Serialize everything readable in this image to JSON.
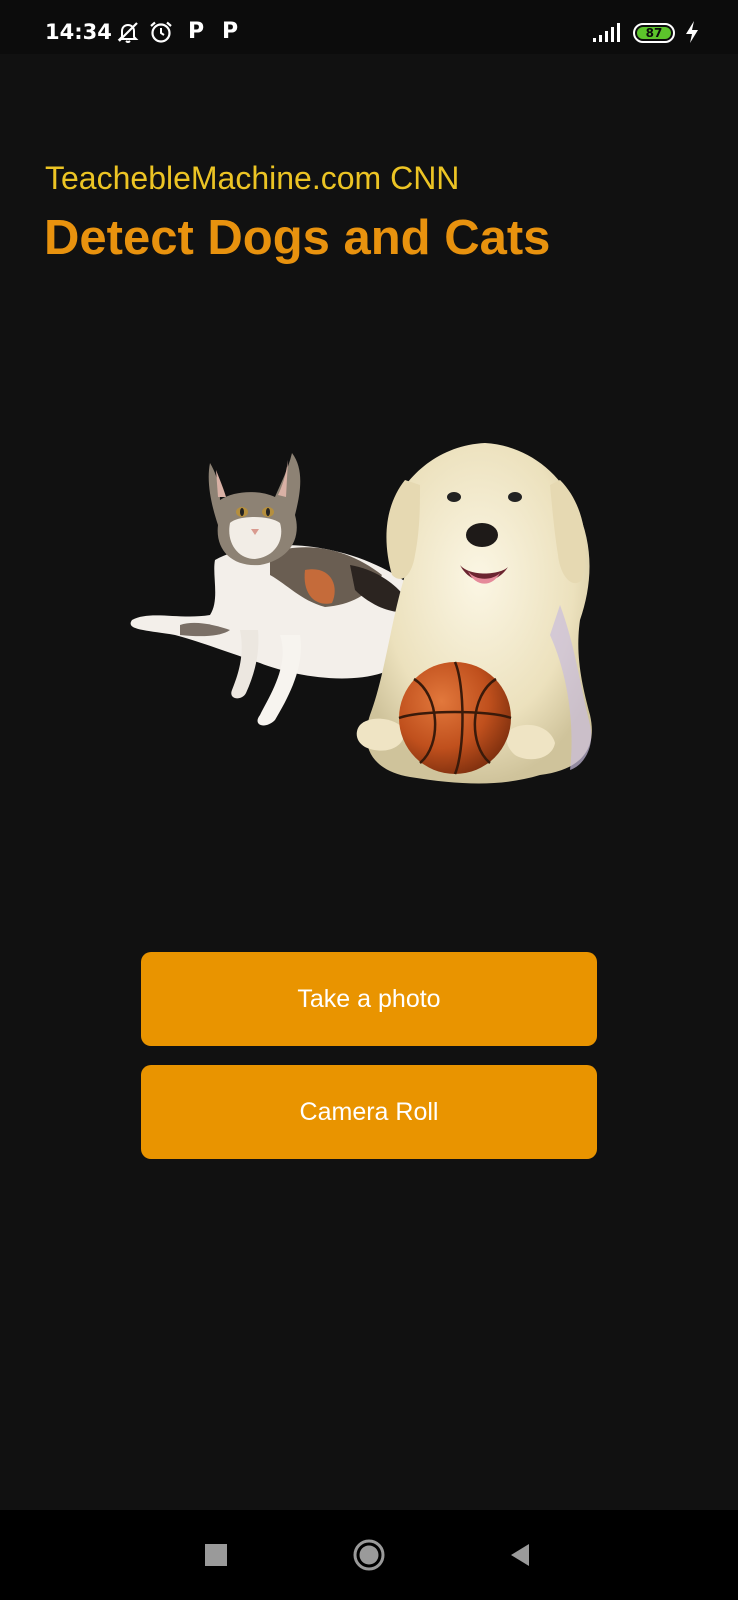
{
  "status_bar": {
    "time": "14:34",
    "icons": [
      "bell-off-icon",
      "alarm-icon",
      "parking-icon",
      "parking-icon",
      "signal-icon",
      "charging-icon"
    ],
    "p1": "P",
    "p2": "P",
    "battery_level": "87",
    "battery_color": "#5cc42b"
  },
  "header": {
    "subtitle": "TeachebleMachine.com CNN",
    "title": "Detect Dogs and Cats"
  },
  "hero": {
    "icons": [
      "cat-image",
      "dog-image",
      "basketball-image"
    ]
  },
  "actions": {
    "take_photo_label": "Take a photo",
    "camera_roll_label": "Camera Roll"
  },
  "colors": {
    "background": "#111111",
    "accent_orange": "#e99400",
    "subtitle_yellow": "#ecc424",
    "title_orange": "#e8920e"
  },
  "nav_bar": {
    "icons": [
      "recent-apps-icon",
      "home-icon",
      "back-icon"
    ]
  }
}
